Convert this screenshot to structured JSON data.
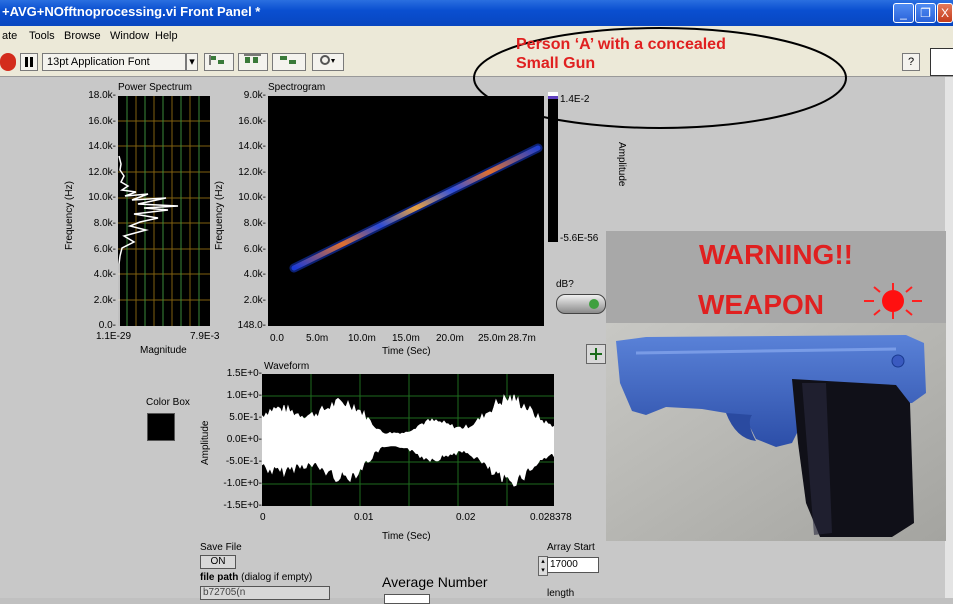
{
  "window": {
    "title": "+AVG+NOfftnoprocessing.vi Front Panel *",
    "buttons": [
      "_",
      "❐",
      "X"
    ]
  },
  "menu": [
    "ate",
    "Tools",
    "Browse",
    "Window",
    "Help"
  ],
  "toolbar": {
    "font_label": "13pt Application Font",
    "help_label": "?"
  },
  "annotation": {
    "line1": "Person ‘A’ with a concealed",
    "line2": "Small Gun"
  },
  "power_spectrum": {
    "title": "Power Spectrum",
    "ylabel": "Frequency (Hz)",
    "xlabel": "Magnitude",
    "yticks": [
      "18.0k-",
      "16.0k-",
      "14.0k-",
      "12.0k-",
      "10.0k-",
      "8.0k-",
      "6.0k-",
      "4.0k-",
      "2.0k-",
      "0.0-"
    ],
    "xmin": "1.1E-29",
    "xmax": "7.9E-3"
  },
  "spectrogram": {
    "title": "Spectrogram",
    "ylabel": "Frequency (Hz)",
    "xlabel": "Time (Sec)",
    "yticks": [
      "9.0k-",
      "16.0k-",
      "14.0k-",
      "12.0k-",
      "10.0k-",
      "8.0k-",
      "6.0k-",
      "4.0k-",
      "2.0k-",
      "148.0-"
    ],
    "xticks": [
      "0.0",
      "5.0m",
      "10.0m",
      "15.0m",
      "20.0m",
      "25.0m",
      "28.7m"
    ],
    "colorbar_max": "1.4E-2",
    "colorbar_min": "-5.6E-56",
    "colorbar_label": "Amplitude"
  },
  "db_toggle": {
    "label": "dB?"
  },
  "waveform": {
    "title": "Waveform",
    "ylabel": "Amplitude",
    "xlabel": "Time (Sec)",
    "yticks": [
      "1.5E+0-",
      "1.0E+0-",
      "5.0E-1-",
      "0.0E+0-",
      "-5.0E-1-",
      "-1.0E+0-",
      "-1.5E+0-"
    ],
    "xticks": [
      "0",
      "0.01",
      "0.02",
      "0.028378"
    ]
  },
  "color_box": {
    "label": "Color Box"
  },
  "save_file": {
    "label": "Save File",
    "state": "ON"
  },
  "file_path": {
    "label_bold": "file path",
    "label_rest": " (dialog if empty)",
    "value": "b72705(n"
  },
  "average_number": {
    "label": "Average Number"
  },
  "array_start": {
    "label": "Array Start",
    "value": "17000"
  },
  "length": {
    "label": "length"
  },
  "warning": {
    "line1": "WARNING!!",
    "line2": "WEAPON"
  }
}
